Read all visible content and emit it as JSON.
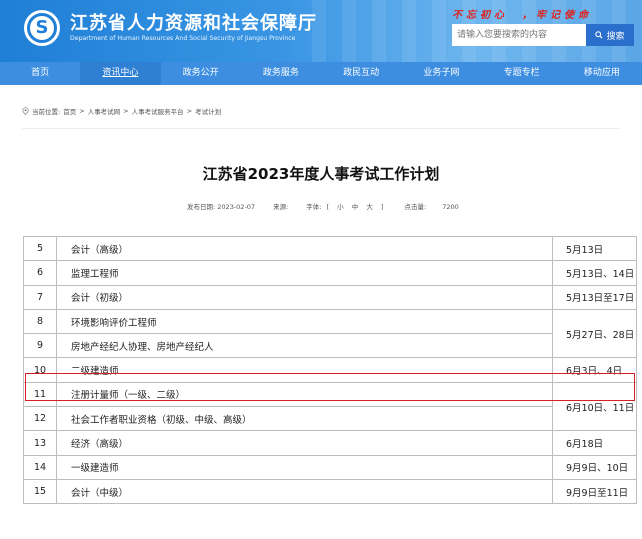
{
  "header": {
    "site_title": "江苏省人力资源和社会保障厅",
    "site_subtitle": "Department of Human Resources And Social Security of Jiangsu Province",
    "slogan": "不忘初心　，牢记使命",
    "search_placeholder": "请输入您要搜索的内容",
    "search_button": "搜索",
    "accent_color": "#1f7fd6"
  },
  "nav": {
    "items": [
      "首页",
      "资讯中心",
      "政务公开",
      "政务服务",
      "政民互动",
      "业务子网",
      "专题专栏",
      "移动应用"
    ],
    "active": "资讯中心"
  },
  "breadcrumb": {
    "prefix": "当前位置:",
    "items": [
      "首页",
      "人事考试网",
      "人事考试服务平台",
      "考试计划"
    ],
    "separator": ">"
  },
  "article": {
    "title": "江苏省2023年度人事考试工作计划",
    "publish_label": "发布日期:",
    "publish_date": "2023-02-07",
    "source_label": "来源:",
    "font_label": "字体:",
    "font_options": [
      "[",
      "小",
      "中",
      "大",
      "]"
    ],
    "views_label": "点击量:",
    "views": "7200"
  },
  "table": {
    "rows": [
      {
        "no": "5",
        "name": "会计（高级）",
        "date": "5月13日"
      },
      {
        "no": "6",
        "name": "监理工程师",
        "date": "5月13日、14日"
      },
      {
        "no": "7",
        "name": "会计（初级）",
        "date": "5月13日至17日"
      },
      {
        "no": "8",
        "name": "环境影响评价工程师",
        "date": "5月27日、28日"
      },
      {
        "no": "9",
        "name": "房地产经纪人协理、房地产经纪人",
        "date": ""
      },
      {
        "no": "10",
        "name": "二级建造师",
        "date": "6月3日、4日"
      },
      {
        "no": "11",
        "name": "注册计量师（一级、二级）",
        "date": "6月10日、11日"
      },
      {
        "no": "12",
        "name": "社会工作者职业资格（初级、中级、高级）",
        "date": ""
      },
      {
        "no": "13",
        "name": "经济（高级）",
        "date": "6月18日"
      },
      {
        "no": "14",
        "name": "一级建造师",
        "date": "9月9日、10日"
      },
      {
        "no": "15",
        "name": "会计（中级）",
        "date": "9月9日至11日"
      }
    ],
    "highlight_color": "#d81f26",
    "highlighted_row": "10"
  }
}
